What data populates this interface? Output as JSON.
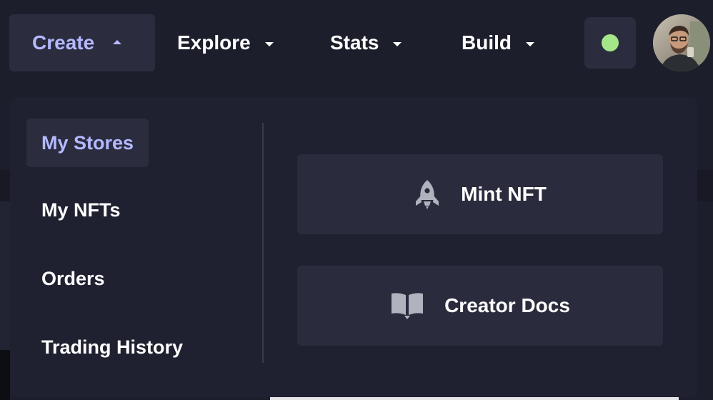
{
  "nav": {
    "items": [
      {
        "label": "Create",
        "active": true
      },
      {
        "label": "Explore",
        "active": false
      },
      {
        "label": "Stats",
        "active": false
      },
      {
        "label": "Build",
        "active": false
      }
    ],
    "status": {
      "icon": "status-dot",
      "color": "#a6e68a"
    },
    "avatar": {
      "icon": "user-avatar"
    }
  },
  "dropdown": {
    "menu": [
      {
        "label": "My Stores",
        "selected": true
      },
      {
        "label": "My NFTs",
        "selected": false
      },
      {
        "label": "Orders",
        "selected": false
      },
      {
        "label": "Trading History",
        "selected": false
      }
    ],
    "actions": [
      {
        "label": "Mint NFT",
        "icon": "rocket-icon"
      },
      {
        "label": "Creator Docs",
        "icon": "book-icon"
      }
    ]
  },
  "colors": {
    "background": "#1d1e2c",
    "panel": "#1f2030",
    "surface": "#2b2c3e",
    "accent": "#b4b9ff",
    "text": "#ffffff"
  }
}
